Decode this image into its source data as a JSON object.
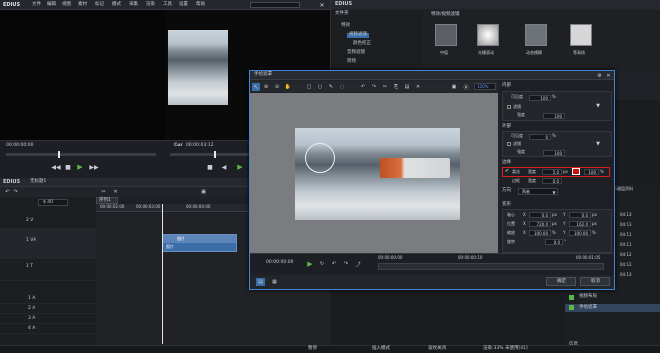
{
  "app": {
    "title": "EDIUS",
    "menu": [
      "文件",
      "编辑",
      "视图",
      "素材",
      "标记",
      "模式",
      "采集",
      "渲染",
      "工具",
      "设置",
      "帮助"
    ]
  },
  "player": {
    "tc_left": "00:00:00:00",
    "label_cur": "Cur",
    "tc_cur": "00:00:03:12",
    "label_cur2": "Cur",
    "tc_cur2": "00:00:00:00",
    "tc_right": "00:00:00:00"
  },
  "timeline_header": {
    "app": "EDIUS",
    "project": "无标题1",
    "seq_tab": "序列1"
  },
  "ruler": [
    "00:00:02:00",
    "00:00:03:00",
    "00:00:04:00"
  ],
  "tracks": {
    "vol": "$ 40",
    "items": [
      "2 V",
      "1 VA",
      "1 T",
      "1 A",
      "2 A",
      "3 A",
      "4 A"
    ]
  },
  "clip": {
    "label1": "图片",
    "label2": "图片",
    "tag": "CH"
  },
  "library": {
    "title": "文件夹",
    "root": "特效",
    "items": [
      "视频滤镜",
      "颜色校正",
      "音频滤镜",
      "转场",
      "音频淡入淡出",
      "字幕混合",
      "键"
    ]
  },
  "effects": {
    "title": "特效/视频滤镜",
    "items": [
      "中值",
      "光栅滚动",
      "动态模糊",
      "等高线"
    ]
  },
  "dialog": {
    "title": "手绘遮罩",
    "zoom": "100%",
    "inner": {
      "title": "内部",
      "opacity": "可见度",
      "opacity_val": "100",
      "unit": "%",
      "filter": "滤镜",
      "strength": "强度",
      "strength_val": "100"
    },
    "outer": {
      "title": "外部",
      "opacity": "可见度",
      "opacity_val": "0",
      "unit": "%",
      "filter": "滤镜",
      "strength": "强度",
      "strength_val": "100"
    },
    "edge": {
      "title": "边缘",
      "soft": "柔化",
      "width": "宽度",
      "width_val": "5.0",
      "width_unit": "px",
      "border": "边框",
      "border_width": "宽度",
      "border_width_val": "0.0",
      "pct": "100",
      "pct_unit": "%",
      "color": "#d01010"
    },
    "dir": {
      "label": "方向",
      "value": "两者"
    },
    "transform": {
      "title": "变形",
      "axis": "轴心",
      "axis_x": "0.0",
      "axis_y": "0.0",
      "pos": "位置",
      "pos_x": "720.0",
      "pos_y": "162.0",
      "scale": "缩放",
      "scale_x": "100.00",
      "scale_y": "100.00",
      "rot": "旋转",
      "rot_val": "0.0",
      "unit": "px",
      "pct": "%",
      "deg": "°",
      "x": "X",
      "y": "Y"
    },
    "tl": {
      "tc_left": "00:00:00:00",
      "tc1": "00:00:00:00",
      "tc2": "00:00:00:10",
      "tc3": "00:00:01:05"
    },
    "ok": "确定",
    "cancel": "取消"
  },
  "right_panel": {
    "tc": [
      "04:13",
      "04:13",
      "04:11",
      "04:11",
      "04:12",
      "04:12",
      "04:13"
    ],
    "label": "显示键盘资料",
    "items": [
      "视频布局",
      "手绘遮罩"
    ]
  },
  "status": {
    "items": [
      "暂停",
      "插入模式",
      "波纹关闭",
      "渲染:33% 未使用[41]"
    ],
    "bottom_left": "信息"
  }
}
